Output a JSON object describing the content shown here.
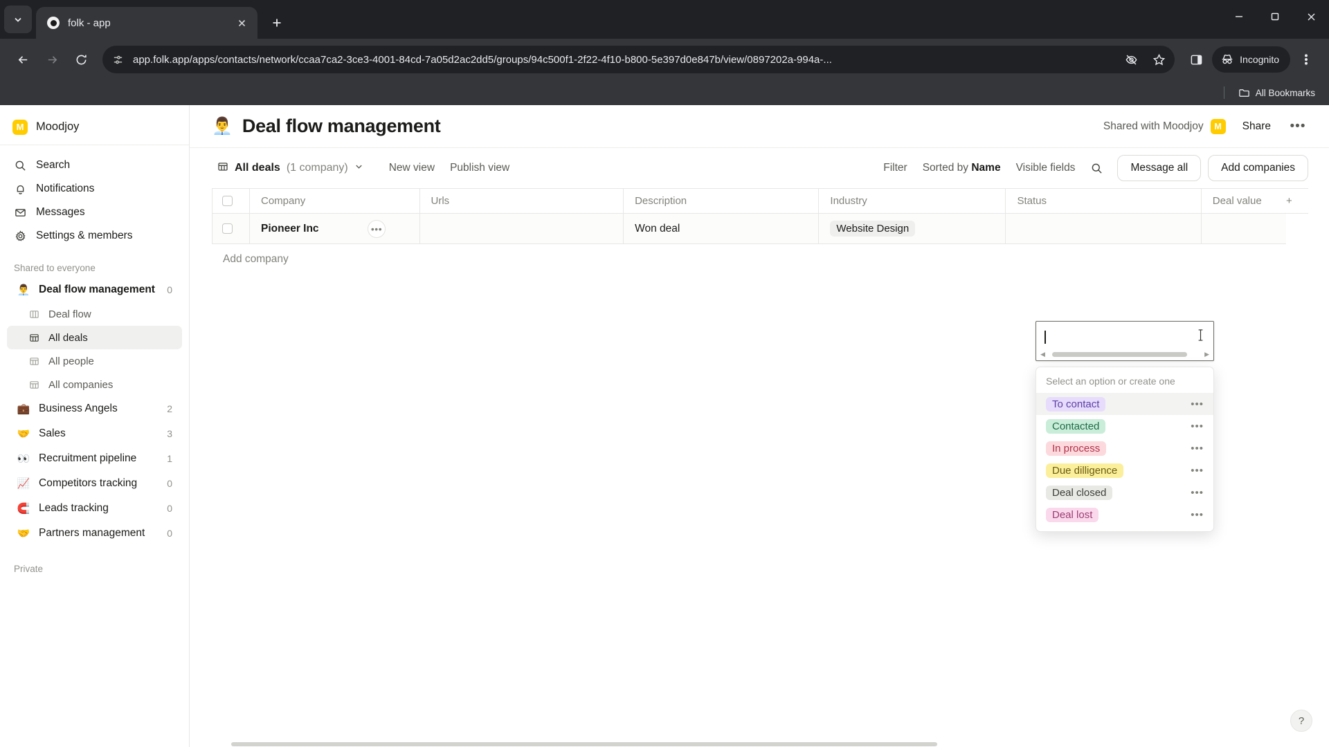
{
  "browser": {
    "tab": {
      "title": "folk - app",
      "favicon": "folk-favicon"
    },
    "new_tab_label": "+",
    "url": "app.folk.app/apps/contacts/network/ccaa7ca2-3ce3-4001-84cd-7a05d2ac2dd5/groups/94c500f1-2f22-4f10-b800-5e397d0e847b/view/0897202a-994a-...",
    "incognito_label": "Incognito",
    "bookmarks_label": "All Bookmarks",
    "icons": {
      "tab_search": "chevron-down-icon",
      "back": "back-arrow-icon",
      "forward": "forward-arrow-icon",
      "reload": "reload-icon",
      "site_info": "site-settings-icon",
      "tracking_off": "eye-crossed-icon",
      "bookmark": "star-icon",
      "side_panel": "side-panel-icon",
      "menu": "three-dot-menu-icon",
      "minimize": "minimize-icon",
      "maximize": "maximize-icon",
      "close": "window-close-icon"
    }
  },
  "sidebar": {
    "workspace": {
      "name": "Moodjoy",
      "initial": "M",
      "color": "#FFCC00"
    },
    "nav": [
      {
        "label": "Search",
        "icon": "search-icon"
      },
      {
        "label": "Notifications",
        "icon": "bell-icon"
      },
      {
        "label": "Messages",
        "icon": "envelope-icon"
      },
      {
        "label": "Settings & members",
        "icon": "gear-icon"
      }
    ],
    "shared_section_label": "Shared to everyone",
    "groups": [
      {
        "label": "Deal flow management",
        "emoji": "👨‍💼",
        "count": "0",
        "active": false
      },
      {
        "label": "Business Angels",
        "emoji": "💼",
        "count": "2",
        "active": false
      },
      {
        "label": "Sales",
        "emoji": "🤝",
        "count": "3",
        "active": false
      },
      {
        "label": "Recruitment pipeline",
        "emoji": "👀",
        "count": "1",
        "active": false
      },
      {
        "label": "Competitors tracking",
        "emoji": "📈",
        "count": "0",
        "active": false
      },
      {
        "label": "Leads tracking",
        "emoji": "🧲",
        "count": "0",
        "active": false
      },
      {
        "label": "Partners management",
        "emoji": "🤝",
        "count": "0",
        "active": false
      }
    ],
    "sub_views": [
      {
        "label": "Deal flow",
        "icon": "board-view-icon",
        "active": false
      },
      {
        "label": "All deals",
        "icon": "table-view-icon",
        "active": true
      },
      {
        "label": "All people",
        "icon": "table-view-icon",
        "active": false
      },
      {
        "label": "All companies",
        "icon": "table-view-icon",
        "active": false
      }
    ],
    "private_section_label": "Private"
  },
  "header": {
    "emoji": "👨‍💼",
    "title": "Deal flow management",
    "shared_with": "Shared with Moodjoy",
    "avatar_initial": "M",
    "share_label": "Share",
    "more_label": "•••"
  },
  "toolbar": {
    "view_name": "All deals",
    "view_count": "(1 company)",
    "new_view_label": "New view",
    "publish_view_label": "Publish view",
    "filter_label": "Filter",
    "sorted_by_prefix": "Sorted by ",
    "sorted_by_field": "Name",
    "visible_fields_label": "Visible fields",
    "search_icon": "search-icon",
    "message_all_label": "Message all",
    "add_companies_label": "Add companies"
  },
  "table": {
    "columns": [
      "Company",
      "Urls",
      "Description",
      "Industry",
      "Status",
      "Deal value"
    ],
    "add_column_label": "+",
    "rows": [
      {
        "company": "Pioneer Inc",
        "urls": "",
        "description": "Won deal",
        "industry": "Website Design",
        "status": "",
        "deal_value": ""
      }
    ],
    "add_row_label": "Add company"
  },
  "edit_cell": {
    "value": "",
    "placeholder": ""
  },
  "dropdown": {
    "hint": "Select an option or create one",
    "options": [
      {
        "label": "To contact",
        "bg": "#e7dcfb",
        "fg": "#5b3fa6",
        "active": true
      },
      {
        "label": "Contacted",
        "bg": "#c9edd9",
        "fg": "#1f6b47",
        "active": false
      },
      {
        "label": "In process",
        "bg": "#fcd9dd",
        "fg": "#b0334a",
        "active": false
      },
      {
        "label": "Due dilligence",
        "bg": "#fbef9b",
        "fg": "#6b5b10",
        "active": false
      },
      {
        "label": "Deal closed",
        "bg": "#e8e8e5",
        "fg": "#3d3d39",
        "active": false
      },
      {
        "label": "Deal lost",
        "bg": "#fbd9ec",
        "fg": "#9c3d72",
        "active": false
      }
    ],
    "item_menu_label": "•••"
  },
  "help": {
    "label": "?"
  }
}
